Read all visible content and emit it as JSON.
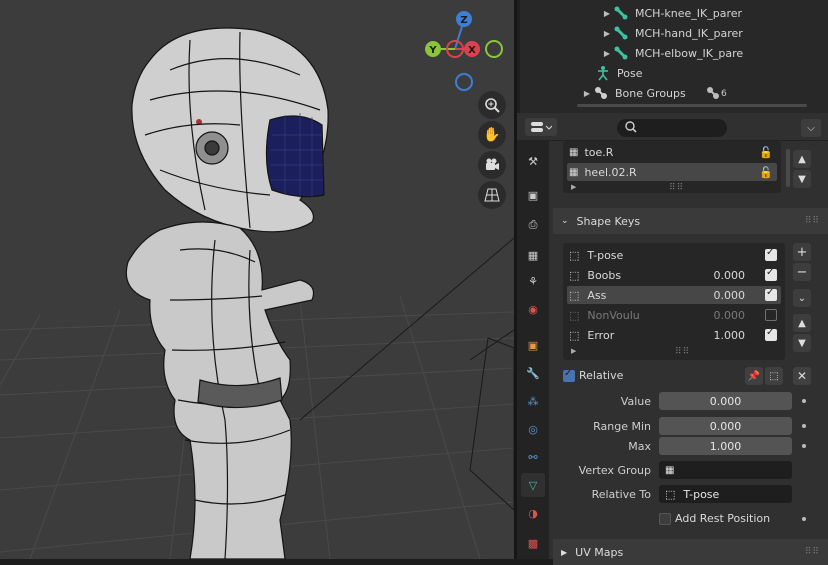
{
  "outliner": {
    "items": [
      {
        "label": "MCH-knee_IK_parer"
      },
      {
        "label": "MCH-hand_IK_parer"
      },
      {
        "label": "MCH-elbow_IK_pare"
      },
      {
        "label": "Pose"
      },
      {
        "label": "Bone Groups",
        "count": "6"
      }
    ]
  },
  "properties": {
    "search_placeholder": "",
    "vertex_groups": [
      {
        "name": "toe.R"
      },
      {
        "name": "heel.02.R"
      }
    ],
    "shape_keys": {
      "title": "Shape Keys",
      "items": [
        {
          "name": "T-pose",
          "value": "",
          "checked": true
        },
        {
          "name": "Boobs",
          "value": "0.000",
          "checked": true
        },
        {
          "name": "Ass",
          "value": "0.000",
          "checked": true
        },
        {
          "name": "NonVoulu",
          "value": "0.000",
          "checked": false
        },
        {
          "name": "Error",
          "value": "1.000",
          "checked": true
        }
      ],
      "relative_label": "Relative",
      "value_label": "Value",
      "value": "0.000",
      "range_min_label": "Range Min",
      "range_min": "0.000",
      "max_label": "Max",
      "max": "1.000",
      "vertex_group_label": "Vertex Group",
      "relative_to_label": "Relative To",
      "relative_to": "T-pose",
      "add_rest_label": "Add Rest Position"
    },
    "uv_maps_title": "UV Maps"
  },
  "gizmo": {
    "z": "Z",
    "y": "Y",
    "x": "X"
  },
  "colors": {
    "accent_blue": "#4772b3",
    "gizmo_x": "#d9434f",
    "gizmo_y": "#8cc43c",
    "gizmo_z": "#3e7fd6"
  }
}
